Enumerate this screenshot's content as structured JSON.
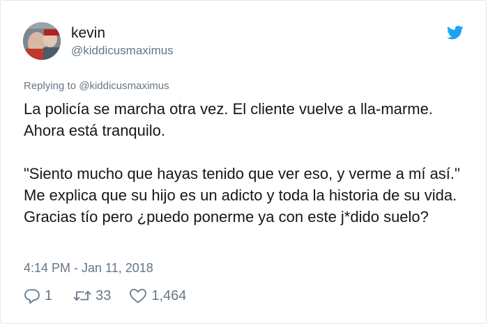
{
  "user": {
    "name": "kevin",
    "handle": "@kiddicusmaximus"
  },
  "reply_to": "Replying to @kiddicusmaximus",
  "paragraphs": [
    "La policía se marcha otra vez. El cliente vuelve a lla-marme. Ahora está tranquilo.",
    "\"Siento mucho que hayas tenido que ver eso, y verme a mí así.\" Me explica que su hijo es un adicto y toda la historia de su vida. Gracias tío pero ¿puedo ponerme ya con este j*dido suelo?"
  ],
  "timestamp": "4:14 PM - Jan 11, 2018",
  "actions": {
    "reply_count": "1",
    "retweet_count": "33",
    "like_count": "1,464"
  },
  "icons": {
    "brand": "twitter-bird-icon",
    "reply": "reply-icon",
    "retweet": "retweet-icon",
    "like": "heart-icon"
  },
  "colors": {
    "brand_blue": "#1da1f2",
    "text": "#14171a",
    "secondary": "#657786",
    "border": "#e1e8ed"
  }
}
